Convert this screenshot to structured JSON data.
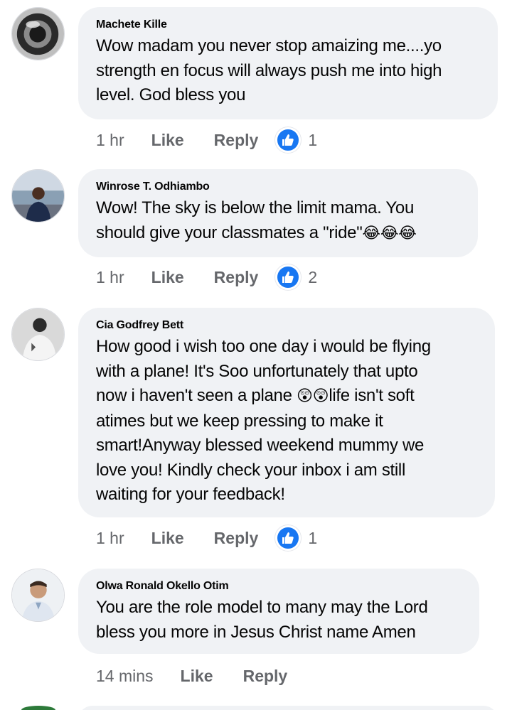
{
  "comments": [
    {
      "author": "Machete Kille",
      "text": "Wow madam you never stop amaizing me....yo\nstrength en focus will always push me into high\nlevel. God bless you",
      "time": "1 hr",
      "like_label": "Like",
      "reply_label": "Reply",
      "reactions": "1",
      "avatar_icon": "profile-photo-icon"
    },
    {
      "author": "Winrose T. Odhiambo",
      "text": "Wow! The sky is below the limit mama. You\nshould give your classmates a \"ride\"",
      "emoji": "😂😂😂",
      "time": "1 hr",
      "like_label": "Like",
      "reply_label": "Reply",
      "reactions": "2",
      "avatar_icon": "profile-photo-icon"
    },
    {
      "author": "Cia Godfrey Bett",
      "text_part1": "How good  i wish too one day i would  be flying\nwith a plane! It's Soo unfortunately that upto\nnow i haven't seen a plane ",
      "emoji": "😲😲",
      "text_part2": "life isn't soft\natimes but we keep pressing to make it\nsmart!Anyway blessed weekend mummy we\nlove you! Kindly check your inbox i am still\nwaiting for your feedback!",
      "time": "1 hr",
      "like_label": "Like",
      "reply_label": "Reply",
      "reactions": "1",
      "avatar_icon": "profile-photo-icon"
    },
    {
      "author": "Olwa Ronald Okello Otim",
      "text": "You are the role model to many may the Lord\nbless you more in Jesus Christ name Amen",
      "time": "14 mins",
      "like_label": "Like",
      "reply_label": "Reply",
      "avatar_icon": "profile-photo-icon"
    }
  ],
  "colors": {
    "bubble_bg": "#f0f2f5",
    "meta_text": "#65676b",
    "like_badge": "#1877f2"
  }
}
